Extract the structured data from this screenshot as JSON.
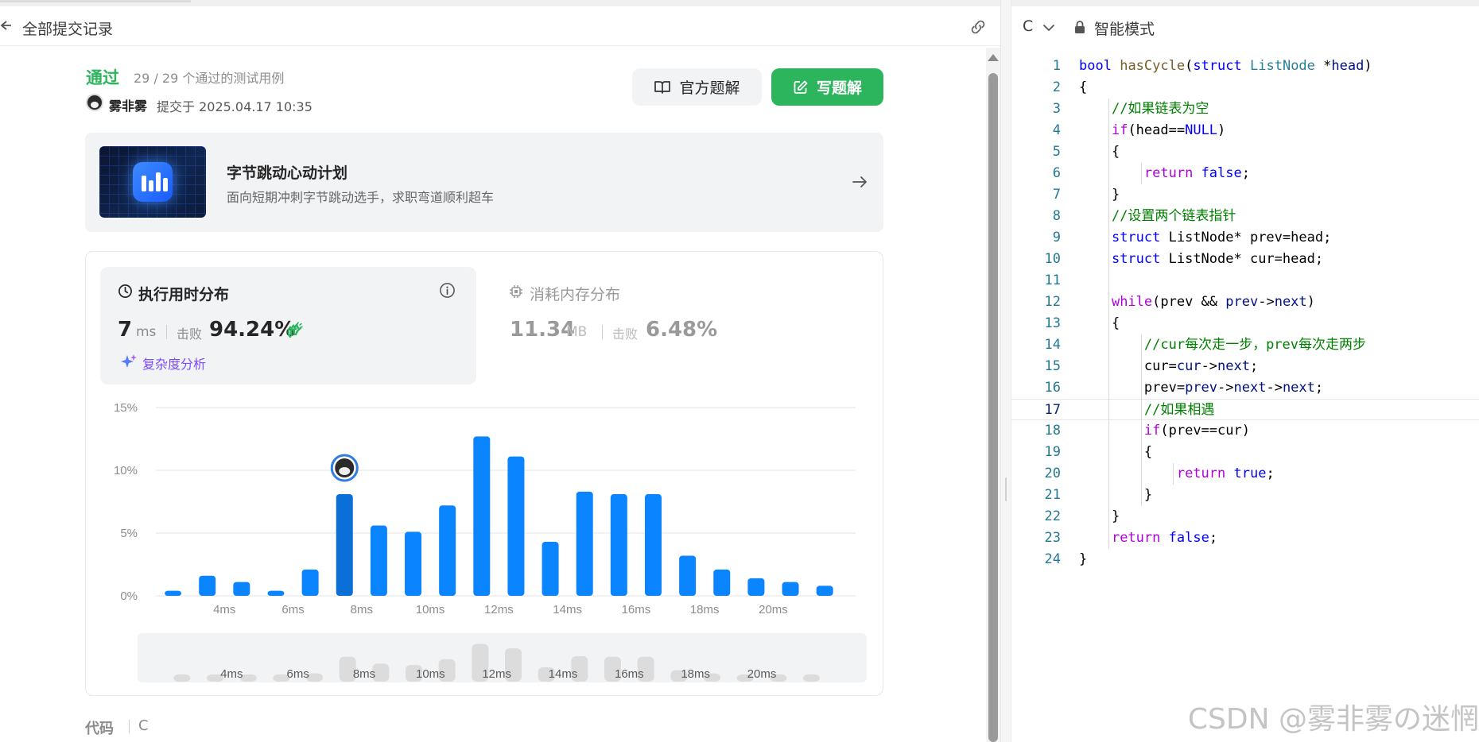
{
  "left_header": {
    "title": "全部提交记录"
  },
  "submission": {
    "status": "通过",
    "cases": "29 / 29 个通过的测试用例",
    "author": "雾非雾",
    "submitted_at": "提交于 2025.04.17 10:35"
  },
  "buttons": {
    "official": "官方题解",
    "write": "写题解"
  },
  "promo": {
    "title": "字节跳动心动计划",
    "subtitle": "面向短期冲刺字节跳动选手，求职弯道顺利超车"
  },
  "runtime": {
    "title": "执行用时分布",
    "value": "7",
    "unit": "ms",
    "beats_label": "击败",
    "beats_value": "94.24%",
    "complexity_link": "复杂度分析"
  },
  "memory": {
    "title": "消耗内存分布",
    "value": "11.34",
    "unit": "MB",
    "beats_label": "击败",
    "beats_value": "6.48%"
  },
  "colors": {
    "pass_green": "#2db55d",
    "bar_blue": "#0a84ff",
    "bar_highlight": "#0a6fd6",
    "grid": "#e5e5e5",
    "mini_bar": "#dcdcdc",
    "purple_link": "#7a4bff"
  },
  "chart_data": {
    "type": "bar",
    "x": [
      2.5,
      3.5,
      4.5,
      5.5,
      6.5,
      7.5,
      8.5,
      9.5,
      10.5,
      11.5,
      12.5,
      13.5,
      14.5,
      15.5,
      16.5,
      17.5,
      18.5,
      19.5,
      20.5,
      21.5
    ],
    "values": [
      0.4,
      1.6,
      1.1,
      0.4,
      2.1,
      8.1,
      5.6,
      5.1,
      7.2,
      12.7,
      11.1,
      4.3,
      8.3,
      8.1,
      8.1,
      3.2,
      2.1,
      1.4,
      1.1,
      0.8
    ],
    "highlight_index": 5,
    "y_ticks": [
      "15%",
      "10%",
      "5%",
      "0%"
    ],
    "y_tick_values": [
      15,
      10,
      5,
      0
    ],
    "x_ticks": [
      "4ms",
      "6ms",
      "8ms",
      "10ms",
      "12ms",
      "14ms",
      "16ms",
      "18ms",
      "20ms"
    ],
    "x_tick_values": [
      4,
      6,
      8,
      10,
      12,
      14,
      16,
      18,
      20
    ],
    "ylim": [
      0,
      15
    ],
    "xlim": [
      2,
      22.4
    ],
    "grid": true,
    "mini_overview": {
      "x_ticks": [
        "4ms",
        "6ms",
        "8ms",
        "10ms",
        "12ms",
        "14ms",
        "16ms",
        "18ms",
        "20ms"
      ]
    }
  },
  "code_footer": {
    "label": "代码",
    "lang": "C"
  },
  "editor_header": {
    "lang": "C",
    "mode": "智能模式"
  },
  "editor": {
    "current_line": 17,
    "lines": [
      [
        [
          "bool",
          "kw"
        ],
        [
          " ",
          ""
        ],
        [
          "hasCycle",
          "fn"
        ],
        [
          "(",
          ""
        ],
        [
          "struct",
          "kw"
        ],
        [
          " ",
          ""
        ],
        [
          "ListNode",
          "ty"
        ],
        [
          " *",
          ""
        ],
        [
          "head",
          "var"
        ],
        [
          ")",
          ""
        ]
      ],
      [
        [
          "{",
          ""
        ]
      ],
      [
        [
          "    ",
          ""
        ],
        [
          "//如果链表为空",
          "cm"
        ]
      ],
      [
        [
          "    ",
          ""
        ],
        [
          "if",
          "ctl"
        ],
        [
          "(head==",
          ""
        ],
        [
          "NULL",
          "kw"
        ],
        [
          ")",
          ""
        ]
      ],
      [
        [
          "    {",
          ""
        ]
      ],
      [
        [
          "        ",
          ""
        ],
        [
          "return",
          "ctl"
        ],
        [
          " ",
          ""
        ],
        [
          "false",
          "kw"
        ],
        [
          ";",
          ""
        ]
      ],
      [
        [
          "    }",
          ""
        ]
      ],
      [
        [
          "    ",
          ""
        ],
        [
          "//设置两个链表指针",
          "cm"
        ]
      ],
      [
        [
          "    ",
          ""
        ],
        [
          "struct",
          "kw"
        ],
        [
          " ListNode* prev=head;",
          ""
        ]
      ],
      [
        [
          "    ",
          ""
        ],
        [
          "struct",
          "kw"
        ],
        [
          " ListNode* cur=head;",
          ""
        ]
      ],
      [
        [
          "",
          ""
        ]
      ],
      [
        [
          "    ",
          ""
        ],
        [
          "while",
          "ctl"
        ],
        [
          "(prev && ",
          ""
        ],
        [
          "prev",
          "var"
        ],
        [
          "->",
          ""
        ],
        [
          "next",
          "var"
        ],
        [
          ")",
          ""
        ]
      ],
      [
        [
          "    {",
          ""
        ]
      ],
      [
        [
          "        ",
          ""
        ],
        [
          "//cur每次走一步，prev每次走两步",
          "cm"
        ]
      ],
      [
        [
          "        cur=",
          ""
        ],
        [
          "cur",
          "var"
        ],
        [
          "->",
          ""
        ],
        [
          "next",
          "var"
        ],
        [
          ";",
          ""
        ]
      ],
      [
        [
          "        prev=",
          ""
        ],
        [
          "prev",
          "var"
        ],
        [
          "->",
          ""
        ],
        [
          "next",
          "var"
        ],
        [
          "->",
          ""
        ],
        [
          "next",
          "var"
        ],
        [
          ";",
          ""
        ]
      ],
      [
        [
          "        ",
          ""
        ],
        [
          "//如果相遇",
          "cm"
        ]
      ],
      [
        [
          "        ",
          ""
        ],
        [
          "if",
          "ctl"
        ],
        [
          "(prev==cur)",
          ""
        ]
      ],
      [
        [
          "        {",
          ""
        ]
      ],
      [
        [
          "            ",
          ""
        ],
        [
          "return",
          "ctl"
        ],
        [
          " ",
          ""
        ],
        [
          "true",
          "kw"
        ],
        [
          ";",
          ""
        ]
      ],
      [
        [
          "        }",
          ""
        ]
      ],
      [
        [
          "    }",
          ""
        ]
      ],
      [
        [
          "    ",
          ""
        ],
        [
          "return",
          "ctl"
        ],
        [
          " ",
          ""
        ],
        [
          "false",
          "kw"
        ],
        [
          ";",
          ""
        ]
      ],
      [
        [
          "}",
          ""
        ]
      ]
    ]
  },
  "watermark": "CSDN @雾非雾の迷惘"
}
